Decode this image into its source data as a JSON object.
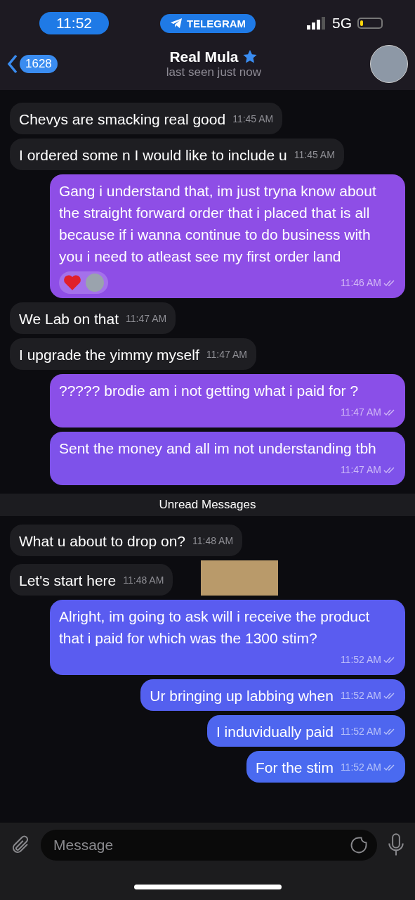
{
  "status_bar": {
    "time": "11:52",
    "app_badge": "TELEGRAM",
    "network": "5G",
    "battery": {
      "level": 0.15
    }
  },
  "header": {
    "back_count": "1628",
    "title": "Real Mula",
    "subtitle": "last seen just now"
  },
  "messages": [
    {
      "kind": "incoming",
      "text": "Chevys are smacking real good",
      "time": "11:45 AM"
    },
    {
      "kind": "incoming",
      "text": "I ordered some n I would like to include u",
      "time": "11:45 AM"
    },
    {
      "kind": "outgoing",
      "text": "Gang i understand that, im just tryna know about the straight forward order that i placed that is all because if i wanna continue to do business with you i need to atleast see my first order land",
      "time": "11:46 AM",
      "read": true,
      "color": "#8e4ee6",
      "reaction": true
    },
    {
      "kind": "incoming",
      "text": "We Lab on that",
      "time": "11:47 AM"
    },
    {
      "kind": "incoming",
      "text": "I upgrade the yimmy myself",
      "time": "11:47 AM"
    },
    {
      "kind": "outgoing",
      "text": "????? brodie am i not getting what i paid for ?",
      "time": "11:47 AM",
      "read": true,
      "color": "#8a4fe8"
    },
    {
      "kind": "outgoing",
      "text": "Sent the money and all im not understanding tbh",
      "time": "11:47 AM",
      "read": true,
      "color": "#7e52ea"
    },
    {
      "kind": "divider",
      "text": "Unread Messages"
    },
    {
      "kind": "incoming",
      "text": "What u about to drop on?",
      "time": "11:48 AM"
    },
    {
      "kind": "incoming",
      "text": "Let's start here",
      "time": "11:48 AM",
      "photo": true
    },
    {
      "kind": "outgoing",
      "text": "Alright, im going to ask will i receive the product that i paid for which was the 1300 stim?",
      "time": "11:52 AM",
      "read": true,
      "color": "#5a5cf0"
    },
    {
      "kind": "outgoing",
      "text": "Ur bringing up labbing when",
      "time": "11:52 AM",
      "read": true,
      "color": "#5460ef"
    },
    {
      "kind": "outgoing",
      "text": "I induvidually paid",
      "time": "11:52 AM",
      "read": true,
      "color": "#4e66ef"
    },
    {
      "kind": "outgoing",
      "text": "For the stim",
      "time": "11:52 AM",
      "read": true,
      "color": "#4a6af0"
    }
  ],
  "composer": {
    "placeholder": "Message"
  }
}
